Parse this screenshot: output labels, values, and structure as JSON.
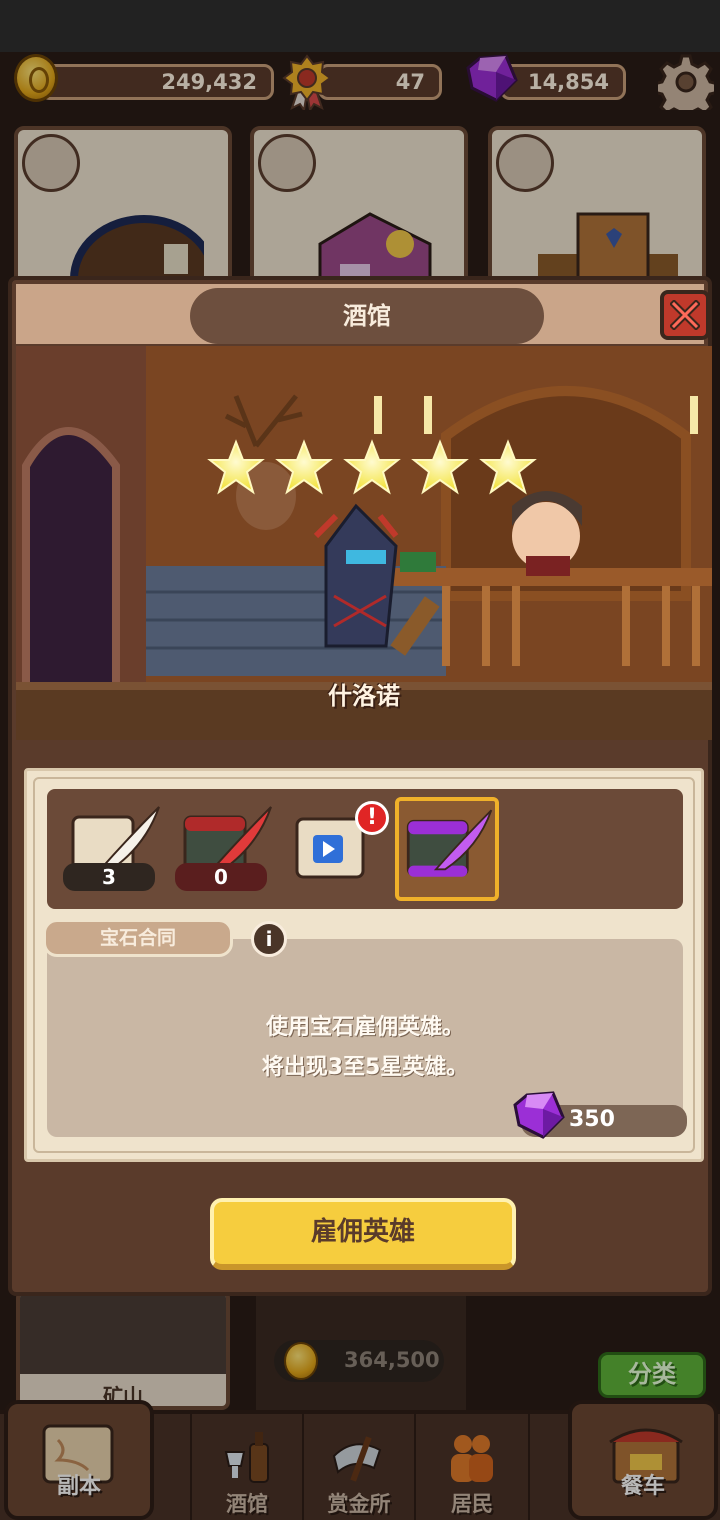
{
  "resources": {
    "gold": "249,432",
    "medals": "47",
    "gems": "14,854"
  },
  "dialog": {
    "title": "酒馆",
    "hero_name": "什洛诺",
    "hero_stars": 5
  },
  "scrolls": [
    {
      "name": "white-scroll",
      "count": "3"
    },
    {
      "name": "red-scroll",
      "count": "0"
    },
    {
      "name": "ad-scroll",
      "alert": "!"
    },
    {
      "name": "gem-scroll",
      "selected": true
    }
  ],
  "contract": {
    "label": "宝石合同",
    "line1": "使用宝石雇佣英雄。",
    "line2": "将出现3至5星英雄。",
    "price": "350"
  },
  "hire_button": "雇佣英雄",
  "background": {
    "lower_card_label": "矿山",
    "coin_cost": "364,500",
    "sort_button": "分类"
  },
  "nav": {
    "dungeon": "副本",
    "tavern": "酒馆",
    "bounty": "赏金所",
    "residents": "居民",
    "dining_car": "餐车"
  },
  "colors": {
    "accent_yellow": "#f6cd3e",
    "gem_purple": "#9b2fd6",
    "close_red": "#c0392b",
    "panel_brown": "#5a3b2b"
  }
}
